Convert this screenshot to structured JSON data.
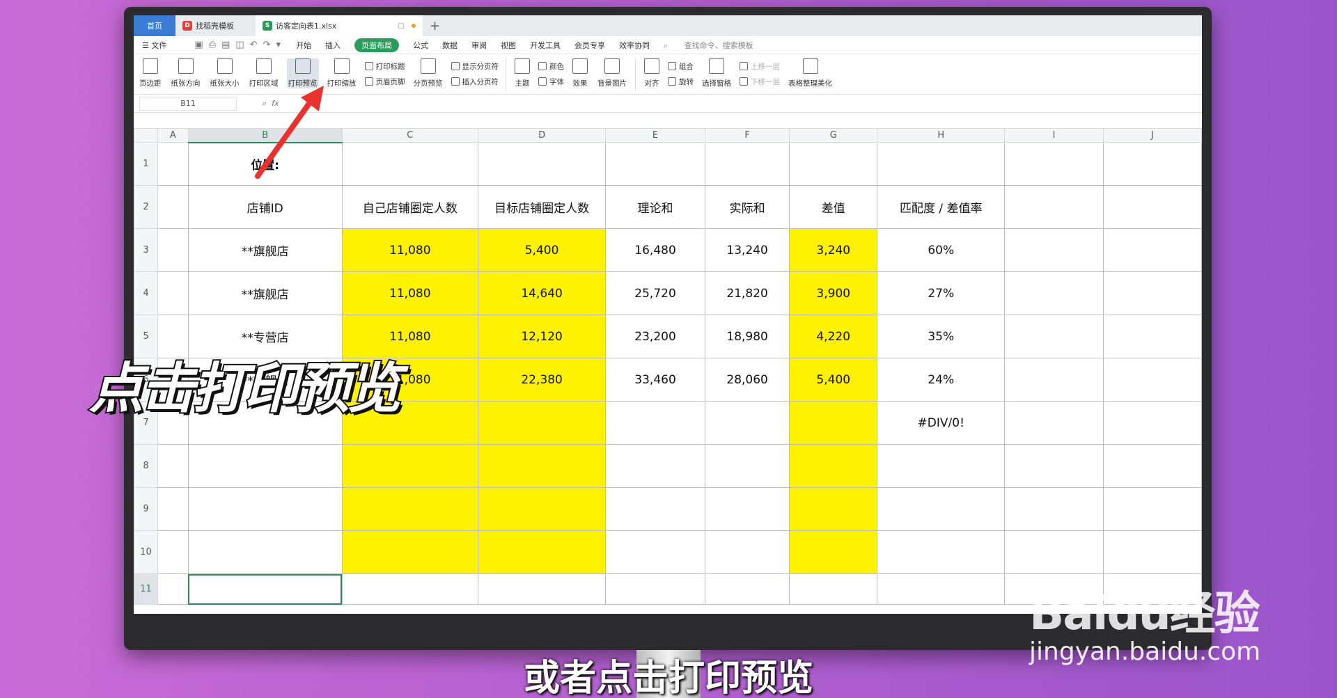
{
  "tabs": [
    {
      "label": "首页"
    },
    {
      "label": "找稻壳模板"
    },
    {
      "label": "访客定向表1.xlsx"
    }
  ],
  "menu": {
    "file": "文件",
    "items": [
      "开始",
      "插入",
      "页面布局",
      "公式",
      "数据",
      "审阅",
      "视图",
      "开发工具",
      "会员专享",
      "效率协同"
    ],
    "active": "页面布局",
    "search": "查找命令、搜索模板"
  },
  "ribbon": {
    "margins": "页边距",
    "orientation": "纸张方向",
    "size": "纸张大小",
    "print_area": "打印区域",
    "print_preview": "打印预览",
    "print_scale": "打印缩放",
    "print_titles": "打印标题",
    "header_footer": "页眉页脚",
    "page_break_preview": "分页预览",
    "show_page_breaks": "显示分页符",
    "insert_page_break": "插入分页符",
    "theme": "主题",
    "colors": "颜色",
    "fonts": "字体",
    "effects": "效果",
    "background": "背景图片",
    "align": "对齐",
    "group": "组合",
    "rotate": "旋转",
    "selection_pane": "选择窗格",
    "bring_forward": "上移一层",
    "send_backward": "下移一层",
    "table_beautify": "表格整理美化"
  },
  "formula_bar": {
    "cell_ref": "B11",
    "fx": "fx"
  },
  "columns": [
    "A",
    "B",
    "C",
    "D",
    "E",
    "F",
    "G",
    "H",
    "I",
    "J"
  ],
  "rows": [
    {
      "num": "1",
      "cells": [
        "",
        "位置:",
        "",
        "",
        "",
        "",
        "",
        "",
        "",
        ""
      ]
    },
    {
      "num": "2",
      "cells": [
        "",
        "店铺ID",
        "自己店铺圈定人数",
        "目标店铺圈定人数",
        "理论和",
        "实际和",
        "差值",
        "匹配度 / 差值率",
        "",
        ""
      ]
    },
    {
      "num": "3",
      "cells": [
        "",
        "**旗舰店",
        "11,080",
        "5,400",
        "16,480",
        "13,240",
        "3,240",
        "60%",
        "",
        ""
      ]
    },
    {
      "num": "4",
      "cells": [
        "",
        "**旗舰店",
        "11,080",
        "14,640",
        "25,720",
        "21,820",
        "3,900",
        "27%",
        "",
        ""
      ]
    },
    {
      "num": "5",
      "cells": [
        "",
        "**专营店",
        "11,080",
        "12,120",
        "23,200",
        "18,980",
        "4,220",
        "35%",
        "",
        ""
      ]
    },
    {
      "num": "6",
      "cells": [
        "",
        "**旗舰店",
        "11,080",
        "22,380",
        "33,460",
        "28,060",
        "5,400",
        "24%",
        "",
        ""
      ]
    },
    {
      "num": "7",
      "cells": [
        "",
        "",
        "",
        "",
        "",
        "",
        "",
        "#DIV/0!",
        "",
        ""
      ]
    },
    {
      "num": "8",
      "cells": [
        "",
        "",
        "",
        "",
        "",
        "",
        "",
        "",
        "",
        ""
      ]
    },
    {
      "num": "9",
      "cells": [
        "",
        "",
        "",
        "",
        "",
        "",
        "",
        "",
        "",
        ""
      ]
    },
    {
      "num": "10",
      "cells": [
        "",
        "",
        "",
        "",
        "",
        "",
        "",
        "",
        "",
        ""
      ]
    },
    {
      "num": "11",
      "cells": [
        "",
        "",
        "",
        "",
        "",
        "",
        "",
        "",
        "",
        ""
      ]
    }
  ],
  "highlight_color": "#fff200",
  "accent_color": "#2a9d5c",
  "overlay": {
    "caption": "点击打印预览",
    "subtitle": "或者点击打印预览",
    "watermark_logo": "Baidu经验",
    "watermark_url": "jingyan.baidu.com"
  }
}
